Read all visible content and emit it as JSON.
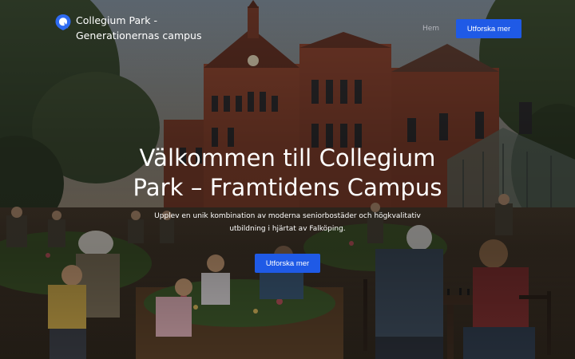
{
  "header": {
    "logo_icon": "location-pin-icon",
    "site_title": "Collegium Park - Generationernas campus",
    "nav": {
      "home_label": "Hem"
    },
    "cta_label": "Utforska mer"
  },
  "hero": {
    "background_image": "campus-courtyard-photo",
    "title": "Välkommen till Collegium Park – Framtidens Campus",
    "subtitle": "Upplev en unik kombination av moderna seniorbostäder och högkvalitativ utbildning i hjärtat av Falköping.",
    "cta_label": "Utforska mer"
  },
  "colors": {
    "accent": "#1f5ae6",
    "nav_link": "#b4b6bd",
    "text": "#ffffff"
  }
}
